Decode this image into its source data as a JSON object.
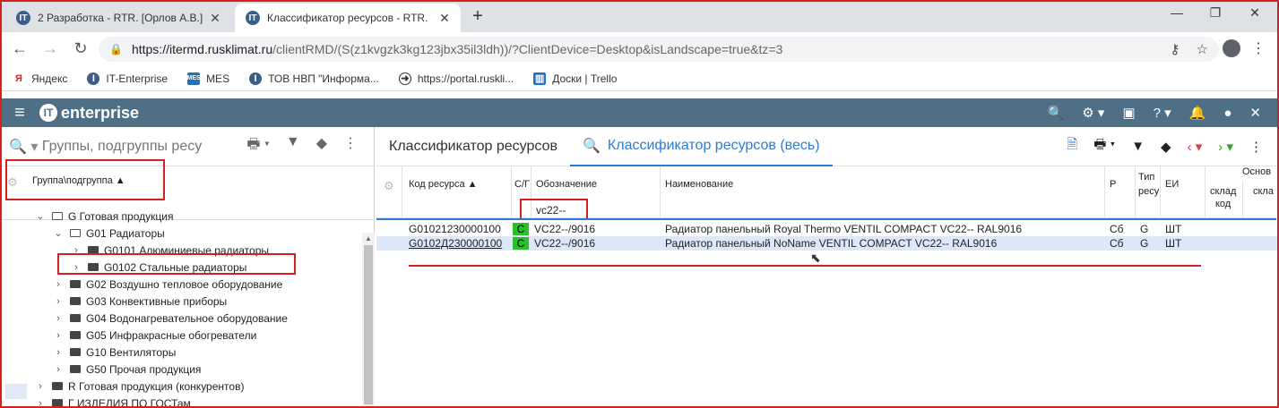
{
  "browser": {
    "tabs": [
      {
        "title": "2 Разработка - RTR. [Орлов А.В.]",
        "close": "✕"
      },
      {
        "title": "Классификатор ресурсов - RTR.",
        "close": "✕"
      }
    ],
    "new_tab": "+",
    "window_controls": [
      "—",
      "❐",
      "✕"
    ],
    "url_host": "https://itermd.rusklimat.ru",
    "url_path": "/clientRMD/(S(z1kvgzk3kg123jbx35il3ldh))/?ClientDevice=Desktop&isLandscape=true&tz=3",
    "bookmarks": [
      {
        "label": "Яндекс",
        "icon": "yandex-icon"
      },
      {
        "label": "IT-Enterprise",
        "icon": "it-icon"
      },
      {
        "label": "MES",
        "icon": "mes-icon"
      },
      {
        "label": "ТОВ НВП \"Информа...",
        "icon": "it-icon"
      },
      {
        "label": "https://portal.ruskli...",
        "icon": "arrow-icon"
      },
      {
        "label": "Доски | Trello",
        "icon": "trello-icon"
      }
    ]
  },
  "app": {
    "logo_text": "enterprise",
    "accent": "#4f6f86"
  },
  "left": {
    "search_placeholder": "Группы, подгруппы ресу",
    "column_header": "Группа\\подгруппа",
    "tree": [
      {
        "label": "G Готовая продукция",
        "level": 2,
        "expanded": true,
        "open": true
      },
      {
        "label": "G01 Радиаторы",
        "level": 3,
        "expanded": true,
        "open": true
      },
      {
        "label": "G0101 Алюминиевые радиаторы",
        "level": 4,
        "expanded": false,
        "open": false
      },
      {
        "label": "G0102 Стальные радиаторы",
        "level": 4,
        "expanded": false,
        "open": false
      },
      {
        "label": "G02 Воздушно тепловое оборудование",
        "level": 3,
        "expanded": false,
        "open": false
      },
      {
        "label": "G03 Конвективные приборы",
        "level": 3,
        "expanded": false,
        "open": false
      },
      {
        "label": "G04 Водонагревательное оборудование",
        "level": 3,
        "expanded": false,
        "open": false
      },
      {
        "label": "G05 Инфракрасные обогреватели",
        "level": 3,
        "expanded": false,
        "open": false
      },
      {
        "label": "G10 Вентиляторы",
        "level": 3,
        "expanded": false,
        "open": false
      },
      {
        "label": "G50 Прочая продукция",
        "level": 3,
        "expanded": false,
        "open": false
      },
      {
        "label": "R Готовая продукция (конкурентов)",
        "level": 2,
        "expanded": false,
        "open": false
      },
      {
        "label": "Г ИЗДЕЛИЯ ПО ГОСТам",
        "level": 2,
        "expanded": false,
        "open": false
      }
    ]
  },
  "right": {
    "tabs": [
      "Классификатор ресурсов",
      "Классификатор ресурсов (весь)"
    ],
    "columns": {
      "code": "Код ресурса",
      "cs": "С/Г",
      "designation": "Обозначение",
      "name": "Наименование",
      "r": "Р",
      "type": "Тип",
      "type2": "ресу",
      "unit": "ЕИ",
      "basic": "Основ",
      "warehouse": "склад",
      "warehouse2": "код",
      "warehouse3": "скла"
    },
    "filter_value": "vc22--",
    "rows": [
      {
        "code": "G01021230000100",
        "cs": "С",
        "designation": "VC22--/9016",
        "name": "Радиатор панельный Royal Thermo VENTIL COMPACT VC22-- RAL9016",
        "r": "Сб",
        "type": "G",
        "unit": "ШТ"
      },
      {
        "code": "G0102Д230000100",
        "cs": "С",
        "designation": "VC22--/9016",
        "name": "Радиатор панельный NoName VENTIL COMPACT VC22-- RAL9016",
        "r": "Сб",
        "type": "G",
        "unit": "ШТ"
      }
    ]
  }
}
